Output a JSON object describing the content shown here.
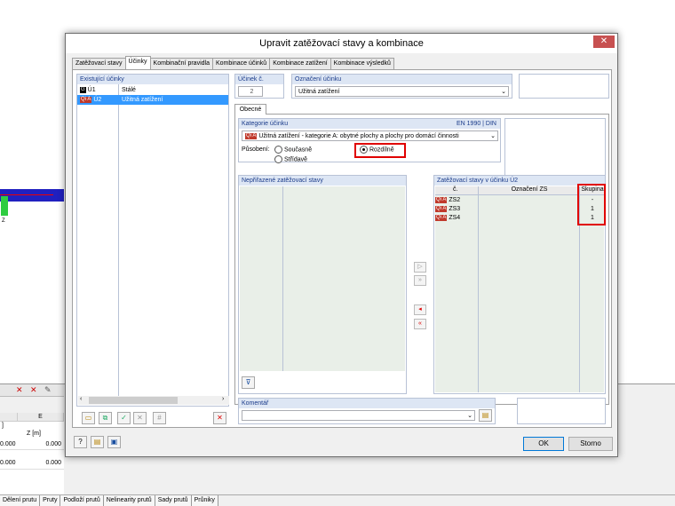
{
  "background": {
    "table_header_col": "E",
    "col_label": "Z [m]",
    "left_unit": "]",
    "row1": [
      "0.000",
      "0.000"
    ],
    "row2": [
      "0.000",
      "0.000"
    ],
    "node_label": "Z",
    "bottom_tabs": [
      "Dělení prutu",
      "Pruty",
      "Podloží prutů",
      "Nelinearity prutů",
      "Sady prutů",
      "Průniky"
    ]
  },
  "dialog": {
    "title": "Upravit zatěžovací stavy a kombinace",
    "tabs": [
      "Zatěžovací stavy",
      "Účinky",
      "Kombinační pravidla",
      "Kombinace účinků",
      "Kombinace zatížení",
      "Kombinace výsledků"
    ],
    "active_tab": "Účinky",
    "existing": {
      "title": "Existující účinky",
      "items": [
        {
          "badge": "G",
          "badge_color": "#000000",
          "id": "Ú1",
          "name": "Stálé"
        },
        {
          "badge": "Qi A",
          "badge_color": "#c0392b",
          "id": "Ú2",
          "name": "Užitná zatížení"
        }
      ]
    },
    "effect_no": {
      "title": "Účinek č.",
      "value": "2"
    },
    "designation": {
      "title": "Označení účinku",
      "value": "Užitná zatížení"
    },
    "subtab": "Obecné",
    "category": {
      "title": "Kategorie účinku",
      "norm": "EN 1990 | DIN",
      "badge": "Qi A",
      "value": "Užitná zatížení - kategorie A: obytné plochy a plochy pro domácí činnosti"
    },
    "action": {
      "label": "Působení:",
      "options": [
        "Současně",
        "Střídavě",
        "Rozdílně"
      ],
      "selected": "Rozdílně"
    },
    "unassigned": {
      "title": "Nepřiřazené zatěžovací stavy"
    },
    "assigned": {
      "title": "Zatěžovací stavy v účinku Ú2",
      "headers": [
        "č.",
        "Označení ZS",
        "Skupina"
      ],
      "rows": [
        {
          "badge": "Qi A",
          "no": "ZS2",
          "name": "",
          "group": "-"
        },
        {
          "badge": "Qi A",
          "no": "ZS3",
          "name": "",
          "group": "1"
        },
        {
          "badge": "Qi A",
          "no": "ZS4",
          "name": "",
          "group": "1"
        }
      ]
    },
    "comment": {
      "title": "Komentář",
      "value": ""
    },
    "buttons": {
      "ok": "OK",
      "cancel": "Storno"
    },
    "accent": "#e00000"
  }
}
